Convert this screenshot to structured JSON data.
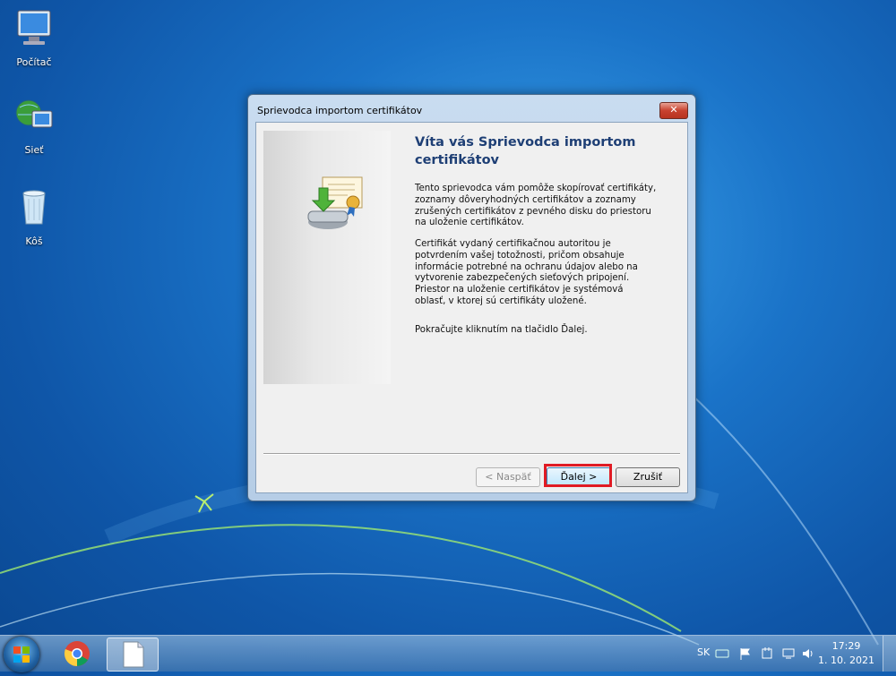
{
  "desktop": {
    "icons": [
      {
        "label": "Počítač",
        "icon": "computer-icon"
      },
      {
        "label": "Sieť",
        "icon": "network-icon"
      },
      {
        "label": "Kôš",
        "icon": "recycle-bin-icon"
      }
    ]
  },
  "window": {
    "title": "Sprievodca importom certifikátov",
    "close_glyph": "✕",
    "heading": "Víta vás Sprievodca importom certifikátov",
    "paragraphs": [
      "Tento sprievodca vám pomôže skopírovať certifikáty, zoznamy dôveryhodných certifikátov a zoznamy zrušených certifikátov z pevného disku do priestoru na uloženie certifikátov.",
      "Certifikát vydaný certifikačnou autoritou je potvrdením vašej totožnosti, pričom obsahuje informácie potrebné na ochranu údajov alebo na vytvorenie zabezpečených sieťových pripojení. Priestor na uloženie certifikátov je systémová oblasť, v ktorej sú certifikáty uložené.",
      "Pokračujte kliknutím na tlačidlo Ďalej."
    ],
    "buttons": {
      "back": "< Naspäť",
      "next": "Ďalej >",
      "cancel": "Zrušiť"
    },
    "highlight_color": "#e01b24"
  },
  "taskbar": {
    "apps": [
      "start-orb",
      "chrome-icon",
      "document-icon"
    ],
    "language": "SK",
    "time": "17:29",
    "date": "1. 10. 2021"
  }
}
